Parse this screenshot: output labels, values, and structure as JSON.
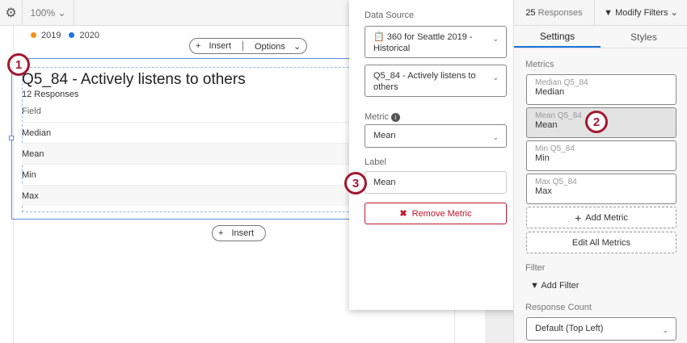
{
  "toolbar": {
    "zoom": "100%"
  },
  "legend": [
    {
      "label": "2019",
      "color": "#f39019"
    },
    {
      "label": "2020",
      "color": "#1a73e8"
    }
  ],
  "widget_toolbar": {
    "insert": "Insert",
    "options": "Options"
  },
  "widget": {
    "title": "Q5_84 - Actively listens to others",
    "responses": "12 Responses",
    "field_header": "Field",
    "rows": [
      "Median",
      "Mean",
      "Min",
      "Max"
    ],
    "insert_below": "Insert"
  },
  "callouts": [
    "1",
    "2",
    "3"
  ],
  "popup": {
    "data_source_label": "Data Source",
    "data_source": "360 for Seattle 2019 - Historical",
    "question": "Q5_84 - Actively listens to others",
    "metric_label": "Metric",
    "metric": "Mean",
    "label_label": "Label",
    "label_value": "Mean",
    "remove": "Remove Metric"
  },
  "right": {
    "responses_count": "25",
    "responses_word": "Responses",
    "modify_filters": "Modify Filters",
    "tabs": [
      "Settings",
      "Styles"
    ],
    "metrics_label": "Metrics",
    "metrics": [
      {
        "sub": "Median Q5_84",
        "name": "Median"
      },
      {
        "sub": "Mean Q5_84",
        "name": "Mean"
      },
      {
        "sub": "Min Q5_84",
        "name": "Min"
      },
      {
        "sub": "Max Q5_84",
        "name": "Max"
      }
    ],
    "add_metric": "Add Metric",
    "edit_all": "Edit All Metrics",
    "filter_label": "Filter",
    "add_filter": "Add Filter",
    "response_count_label": "Response Count",
    "response_count_value": "Default (Top Left)"
  }
}
